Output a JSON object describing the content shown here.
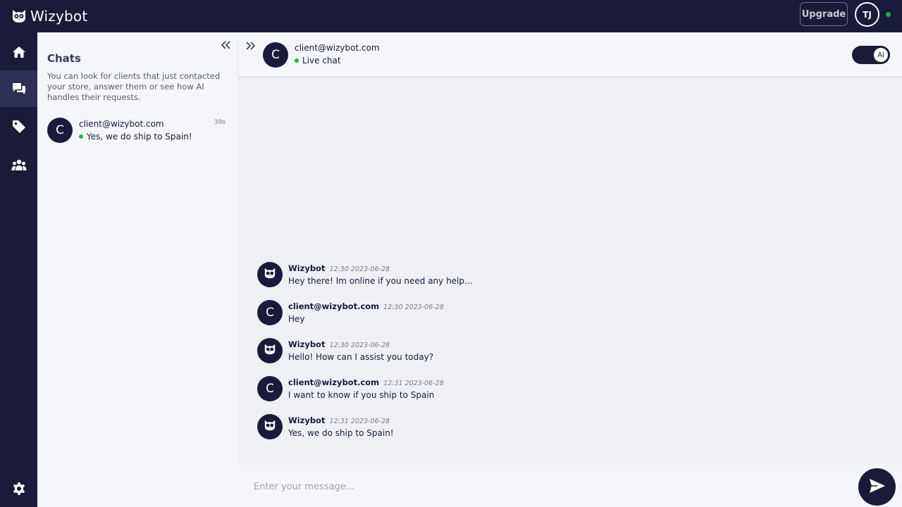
{
  "app": {
    "brand_name": "Wizybot",
    "upgrade_label": "Upgrade",
    "user_initials": "TJ",
    "colors": {
      "navy": "#1a1b3a",
      "online_green": "#1fae4a",
      "panel_bg": "#f5f6f9",
      "chat_bg": "#eff0f4"
    }
  },
  "nav": {
    "items": [
      {
        "icon": "home-icon"
      },
      {
        "icon": "chat-bubbles-icon",
        "active": true
      },
      {
        "icon": "tag-icon"
      },
      {
        "icon": "team-icon"
      }
    ],
    "settings_icon": "gear-icon"
  },
  "chats_panel": {
    "title": "Chats",
    "description": "You can look for clients that just contacted your store, answer them or see how AI handles their requests.",
    "entries": [
      {
        "initial": "C",
        "name": "client@wizybot.com",
        "time": "39s",
        "preview": "Yes, we do ship to Spain!"
      }
    ]
  },
  "conversation": {
    "initial": "C",
    "name": "client@wizybot.com",
    "status": "Live chat",
    "ai_toggle_label": "AI",
    "ai_enabled": true,
    "messages": [
      {
        "sender": "Wizybot",
        "time": "12:30 2023-06-28",
        "text": "Hey there! Im online if you need any help...",
        "is_bot": true
      },
      {
        "sender": "client@wizybot.com",
        "time": "12:30 2023-06-28",
        "text": "Hey",
        "is_bot": false,
        "initial": "C"
      },
      {
        "sender": "Wizybot",
        "time": "12:30 2023-06-28",
        "text": "Hello! How can I assist you today?",
        "is_bot": true
      },
      {
        "sender": "client@wizybot.com",
        "time": "12:31 2023-06-28",
        "text": "I want to know if you ship to Spain",
        "is_bot": false,
        "initial": "C"
      },
      {
        "sender": "Wizybot",
        "time": "12:31 2023-06-28",
        "text": "Yes, we do ship to Spain!",
        "is_bot": true
      }
    ]
  },
  "composer": {
    "placeholder": "Enter your message...",
    "value": ""
  }
}
